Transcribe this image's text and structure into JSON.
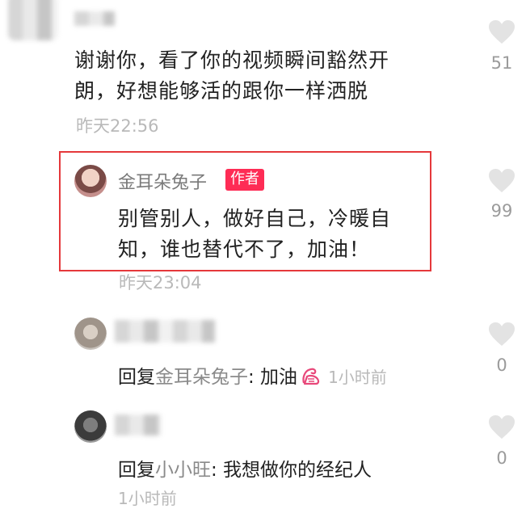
{
  "comments": [
    {
      "text": "谢谢你，看了你的视频瞬间豁然开朗，好想能够活的跟你一样洒脱",
      "line1": "谢谢你，看了你的视频瞬间豁然开",
      "line2": "朗，好想能够活的跟你一样洒脱",
      "time": "昨天22:56",
      "likes": "51"
    },
    {
      "author": "金耳朵兔子",
      "badge": "作者",
      "line1": "别管别人，做好自己，冷暖自",
      "line2": "知，谁也替代不了，加油！",
      "time": "昨天23:04",
      "likes": "99"
    },
    {
      "reply_prefix": "回复",
      "reply_to": "金耳朵兔子",
      "reply_text": ": 加油",
      "time": "1小时前",
      "likes": "0"
    },
    {
      "reply_prefix": "回复",
      "reply_to": "小小旺",
      "reply_text": ": 我想做你的经纪人",
      "time": "1小时前",
      "likes": "0"
    }
  ],
  "colors": {
    "badge": "#fe2c55",
    "highlight_border": "#e5383b",
    "heart": "#e3e3e3"
  },
  "icons": [
    "heart-icon",
    "flex-arm-emoji-icon"
  ]
}
